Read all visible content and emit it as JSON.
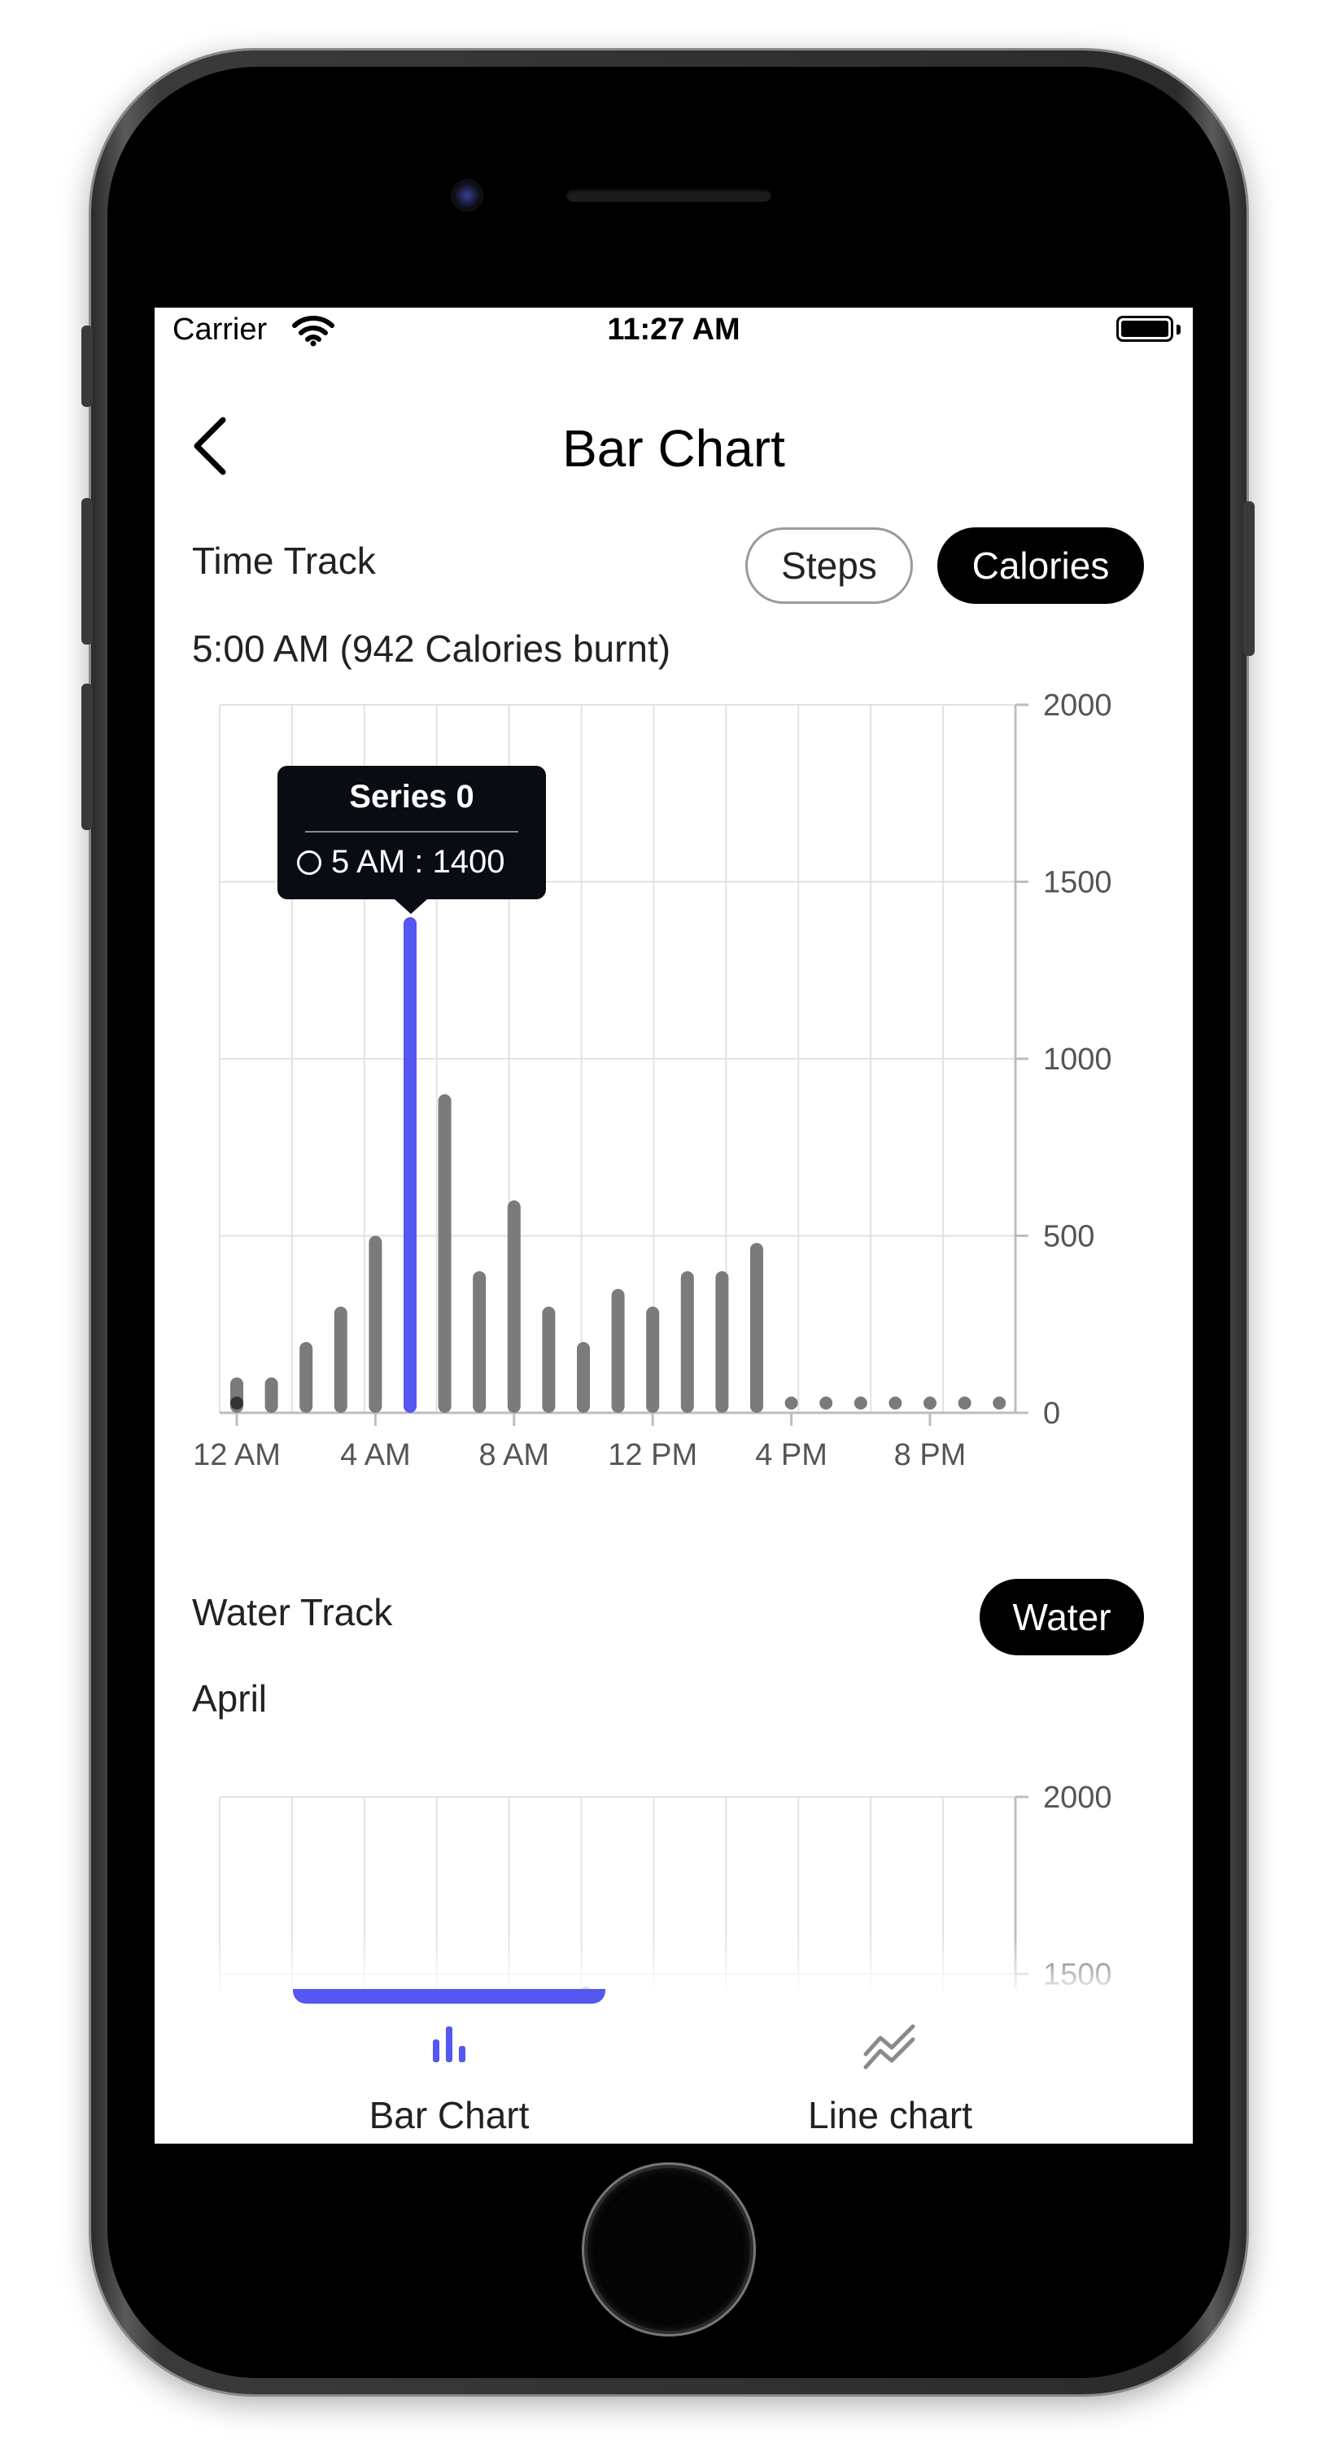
{
  "status_bar": {
    "carrier": "Carrier",
    "time": "11:27 AM"
  },
  "header": {
    "title": "Bar Chart"
  },
  "time_track": {
    "title": "Time Track",
    "toggles": [
      {
        "label": "Steps",
        "selected": false
      },
      {
        "label": "Calories",
        "selected": true
      }
    ],
    "selection_text": "5:00 AM (942 Calories burnt)",
    "tooltip": {
      "title": "Series 0",
      "text": "5 AM : 1400"
    }
  },
  "water_track": {
    "title": "Water Track",
    "toggle_label": "Water",
    "subtitle": "April"
  },
  "bottom_nav": {
    "tabs": [
      {
        "label": "Bar Chart",
        "icon": "bar-chart-icon",
        "active": true
      },
      {
        "label": "Line chart",
        "icon": "line-chart-icon",
        "active": false
      }
    ]
  },
  "colors": {
    "highlight": "#5457f0",
    "bar": "#7b7b7b",
    "chip_active_bg": "#000000"
  },
  "chart_data": [
    {
      "type": "bar",
      "series": [
        {
          "name": "Series 0",
          "values": [
            100,
            100,
            200,
            300,
            500,
            1400,
            900,
            400,
            600,
            300,
            200,
            350,
            300,
            400,
            400,
            480,
            0,
            0,
            0,
            0,
            0,
            0,
            0
          ]
        }
      ],
      "x_ticks": [
        "12 AM",
        "4 AM",
        "8 AM",
        "12 PM",
        "4 PM",
        "8 PM"
      ],
      "y_ticks": [
        "0",
        "500",
        "1000",
        "1500",
        "2000"
      ],
      "ylim": [
        0,
        2000
      ],
      "highlighted_category": "5 AM",
      "highlighted_value": 1400,
      "grid": true,
      "y_axis_side": "right"
    },
    {
      "type": "bar",
      "y_ticks": [
        "1500",
        "2000"
      ],
      "ylim": [
        0,
        2000
      ],
      "grid": true,
      "y_axis_side": "right"
    }
  ]
}
